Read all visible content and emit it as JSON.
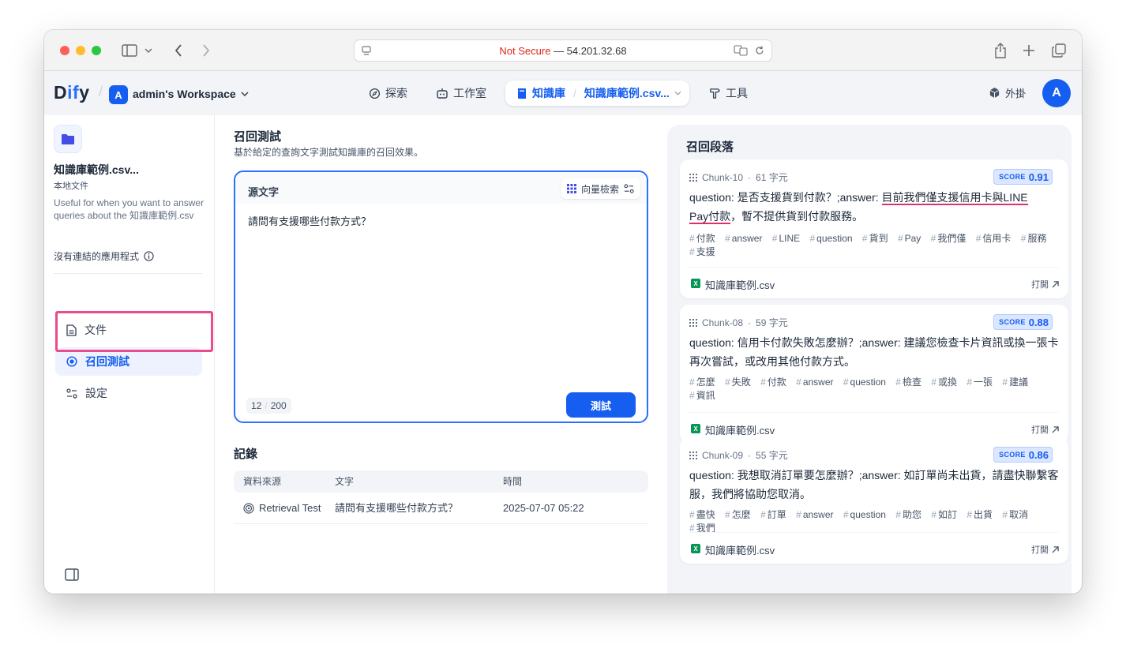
{
  "browser": {
    "not_secure": "Not Secure",
    "url": "— 54.201.32.68"
  },
  "app": {
    "logo": {
      "prefix": "D",
      "mid": "if",
      "suffix": "y"
    },
    "workspace_initial": "A",
    "workspace_name": "admin's Workspace",
    "nav": {
      "explore": "探索",
      "studio": "工作室",
      "knowledge": "知識庫",
      "current_dataset": "知識庫範例.csv...",
      "tools": "工具",
      "plugins": "外掛"
    },
    "user_initial": "A"
  },
  "sidebar": {
    "kb_name": "知識庫範例.csv...",
    "kb_type": "本地文件",
    "kb_description": "Useful for when you want to answer queries about the 知識庫範例.csv",
    "linked_apps": "沒有連結的應用程式",
    "items": [
      {
        "label": "文件"
      },
      {
        "label": "召回測試"
      },
      {
        "label": "設定"
      }
    ]
  },
  "retrieval": {
    "title": "召回測試",
    "subtitle": "基於給定的查詢文字測試知識庫的召回效果。",
    "source_label": "源文字",
    "mode": "向量檢索",
    "query": "請問有支援哪些付款方式？",
    "char_count": "12",
    "char_limit": "200",
    "test_button": "測試"
  },
  "records": {
    "title": "記錄",
    "headers": [
      "資料來源",
      "文字",
      "時間"
    ],
    "rows": [
      {
        "source": "Retrieval Test",
        "text": "請問有支援哪些付款方式？",
        "time": "2025-07-07 05:22"
      }
    ]
  },
  "results": {
    "title": "召回段落",
    "score_label": "SCORE",
    "open_label": "打開",
    "chunks": [
      {
        "id": "Chunk-10",
        "chars": "61 字元",
        "score": "0.91",
        "content_a": "question: 是否支援貨到付款？;answer: ",
        "content_hl1": "目前我們僅支援信用卡與LINE",
        "content_hl2": "Pay付款",
        "content_b": "，暫不提供貨到付款服務。",
        "tags": [
          "付款",
          "answer",
          "LINE",
          "question",
          "貨到",
          "Pay",
          "我們僅",
          "信用卡",
          "服務",
          "支援"
        ],
        "file": "知識庫範例.csv"
      },
      {
        "id": "Chunk-08",
        "chars": "59 字元",
        "score": "0.88",
        "content": "question: 信用卡付款失敗怎麼辦？;answer: 建議您檢查卡片資訊或換一張卡再次嘗試，或改用其他付款方式。",
        "tags": [
          "怎麼",
          "失敗",
          "付款",
          "answer",
          "question",
          "檢查",
          "或換",
          "一張",
          "建議",
          "資訊"
        ],
        "file": "知識庫範例.csv"
      },
      {
        "id": "Chunk-09",
        "chars": "55 字元",
        "score": "0.86",
        "content": "question: 我想取消訂單要怎麼辦？;answer: 如訂單尚未出貨，請盡快聯繫客服，我們將協助您取消。",
        "tags": [
          "盡快",
          "怎麼",
          "訂單",
          "answer",
          "question",
          "助您",
          "如訂",
          "出貨",
          "取消",
          "我們"
        ],
        "file": "知識庫範例.csv"
      }
    ]
  },
  "colors": {
    "accent": "#155eef",
    "highlight_box": "#ea4b8b",
    "underline": "#e02f6e"
  }
}
